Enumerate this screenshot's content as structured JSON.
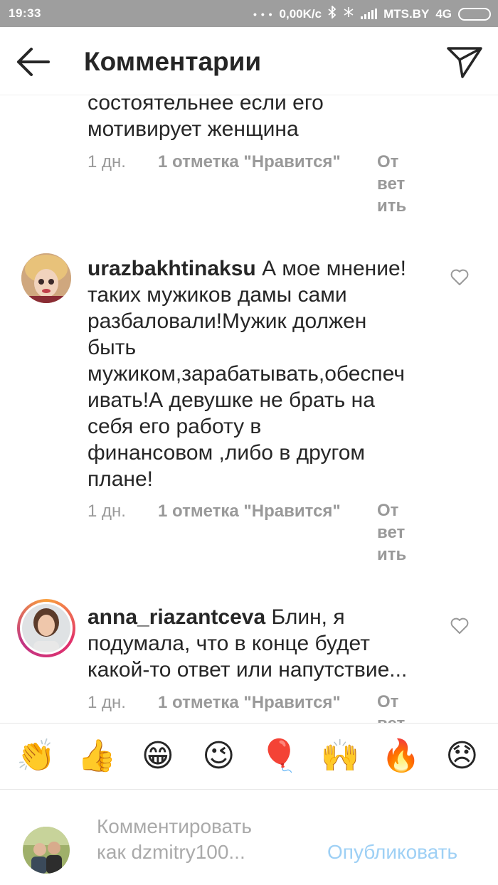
{
  "status_bar": {
    "time": "19:33",
    "dots": "• • •",
    "net_speed": "0,00K/c",
    "bluetooth_icon": "bluetooth-icon",
    "carrier": "MTS.BY",
    "network": "4G"
  },
  "header": {
    "title": "Комментарии",
    "back_icon": "arrow-left-icon",
    "send_icon": "paper-plane-icon"
  },
  "comments": [
    {
      "text_lines": [
        "состоятельнее если его",
        "мотивирует женщина"
      ],
      "time": "1 дн.",
      "likes": "1 отметка \"Нравится\"",
      "reply_lines": [
        "От",
        "вет",
        "ить"
      ]
    },
    {
      "username": "urazbakhtinaksu",
      "text_first": "А мое мнение!",
      "text_lines": [
        "таких мужиков дамы сами",
        "разбаловали!Мужик должен",
        "быть",
        "мужиком,зарабатывать,обеспеч",
        "ивать!А девушке не брать на",
        "себя его работу в",
        "финансовом ,либо в другом",
        "плане!"
      ],
      "time": "1 дн.",
      "likes": "1 отметка \"Нравится\"",
      "reply_lines": [
        "От",
        "вет",
        "ить"
      ]
    },
    {
      "username": "anna_riazantceva",
      "text_first": "Блин, я",
      "text_lines": [
        "подумала, что в конце будет",
        "какой-то ответ или напутствие..."
      ],
      "time": "1 дн.",
      "likes": "1 отметка \"Нравится\"",
      "reply_lines": [
        "От",
        "вет"
      ]
    }
  ],
  "emoji_bar": [
    "👏",
    "👍",
    "😁",
    "😉",
    "🎈",
    "🙌",
    "🔥",
    "😞"
  ],
  "composer": {
    "placeholder_line1": "Комментировать",
    "placeholder_line2": "как dzmitry100...",
    "publish_label": "Опубликовать"
  },
  "colors": {
    "status_bar": "#9e9e9e",
    "text": "#262626",
    "meta": "#999999",
    "publish": "#9ed0f5",
    "story_ring": "#e1306c"
  }
}
